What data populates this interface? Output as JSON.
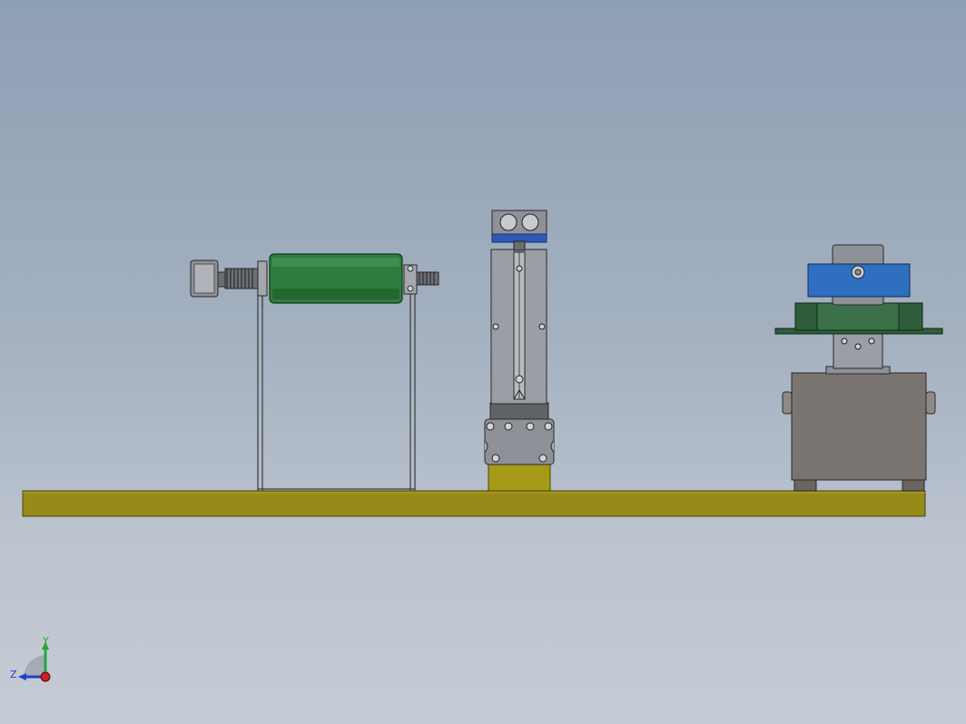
{
  "app": {
    "title": ""
  },
  "viewport": {
    "background_top": "#8e9fb4",
    "background_bottom": "#c6ccd5"
  },
  "model": {
    "parts": [
      {
        "name": "base-plate",
        "color": "#968a18"
      },
      {
        "name": "roller-drum",
        "color": "#2f7d3e"
      },
      {
        "name": "linear-actuator",
        "color": "#9a9ea5"
      },
      {
        "name": "motor-housing",
        "color": "#7a7470"
      },
      {
        "name": "top-clamp",
        "color": "#2f6fc0"
      },
      {
        "name": "mount-plate",
        "color": "#2e5d3a"
      }
    ]
  },
  "triad": {
    "x_axis_color": "#c8202a",
    "y_axis_label": "Y",
    "y_axis_color": "#22a838",
    "z_axis_label": "Z",
    "z_axis_color": "#2040d0"
  }
}
